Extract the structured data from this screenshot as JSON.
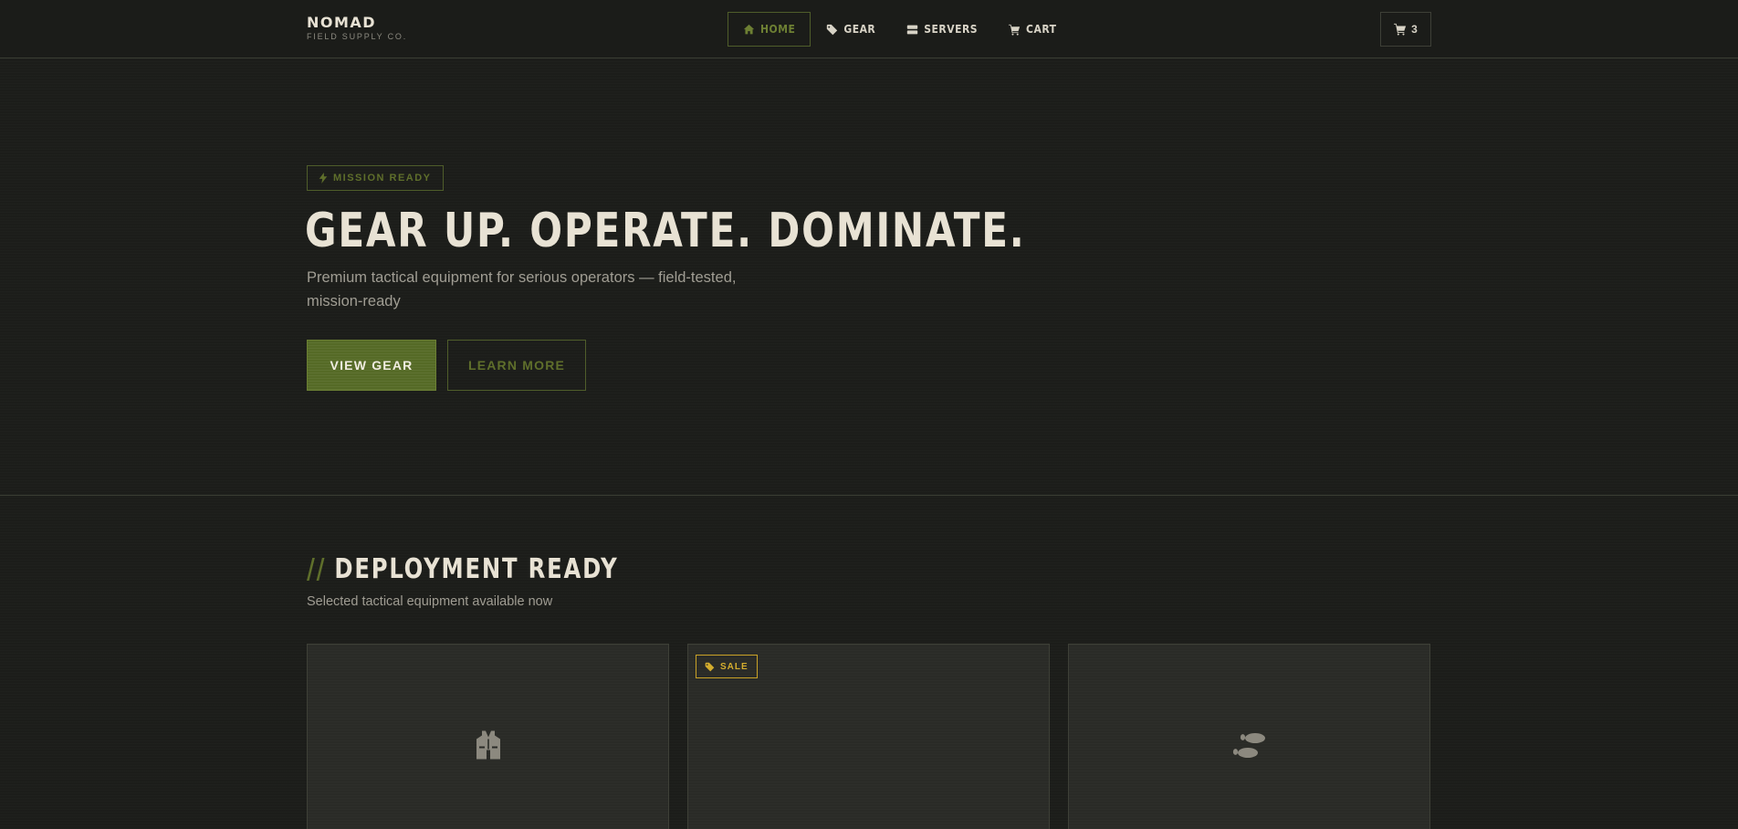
{
  "brand": {
    "name": "NOMAD",
    "subtitle": "FIELD SUPPLY CO."
  },
  "nav": {
    "items": [
      {
        "label": "HOME",
        "icon": "home-icon",
        "active": true
      },
      {
        "label": "GEAR",
        "icon": "tag-icon",
        "active": false
      },
      {
        "label": "SERVERS",
        "icon": "server-icon",
        "active": false
      },
      {
        "label": "CART",
        "icon": "cart-icon",
        "active": false
      }
    ],
    "cart_count": "3"
  },
  "hero": {
    "badge": "MISSION READY",
    "title": "GEAR UP. OPERATE. DOMINATE.",
    "subtitle": "Premium tactical equipment for serious operators — field-tested, mission-ready",
    "primary_button": "VIEW GEAR",
    "secondary_button": "LEARN MORE"
  },
  "section": {
    "title_prefix": "//",
    "title": "DEPLOYMENT READY",
    "subtitle": "Selected tactical equipment available now"
  },
  "products": [
    {
      "icon": "vest-icon",
      "badge": ""
    },
    {
      "icon": "",
      "badge": "SALE"
    },
    {
      "icon": "footprints-icon",
      "badge": ""
    }
  ],
  "colors": {
    "background": "#1c1d1a",
    "accent_olive": "#556a26",
    "accent_olive_text": "#5f6f2b",
    "sale_gold": "#c9a227",
    "text_primary": "#e8e2d4",
    "text_muted": "#a09d93"
  }
}
